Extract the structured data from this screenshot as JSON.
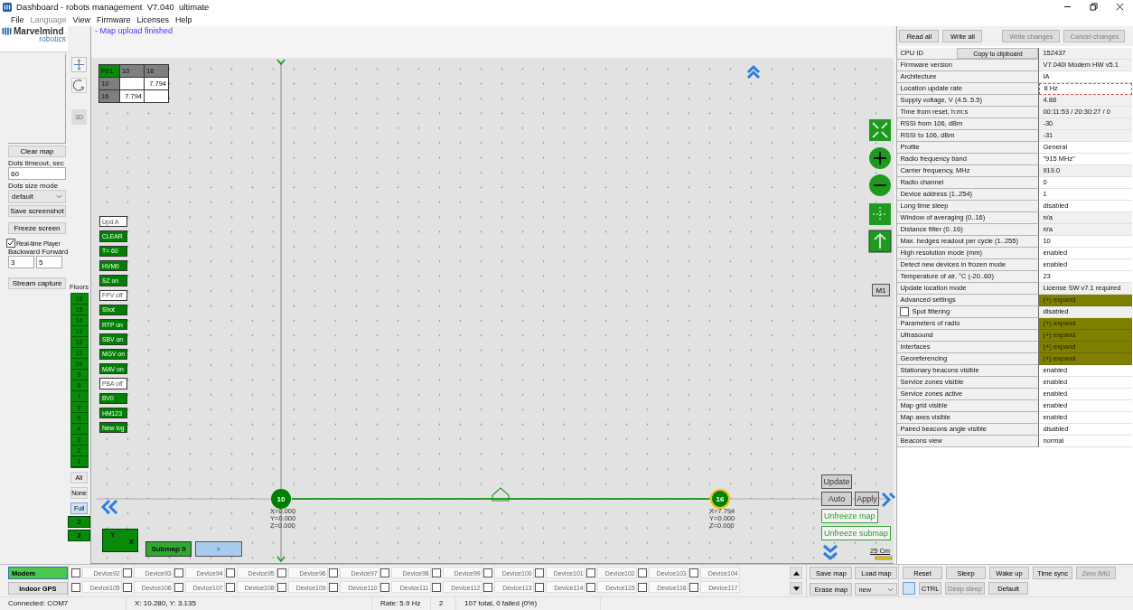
{
  "window": {
    "title": "Dashboard - robots management  V7.040  ultimate"
  },
  "menu": [
    {
      "label": "File",
      "disabled": false
    },
    {
      "label": "Language",
      "disabled": true
    },
    {
      "label": "View",
      "disabled": false
    },
    {
      "label": "Firmware",
      "disabled": false
    },
    {
      "label": "Licenses",
      "disabled": false
    },
    {
      "label": "Help",
      "disabled": false
    }
  ],
  "left_panel": {
    "logo": "Marvelmind",
    "logo_sub": "robotics",
    "clear_button": "Clear map",
    "dots_timeout": {
      "label": "Dots timeout, sec",
      "value": "60"
    },
    "dots_size": {
      "label": "Dots size mode",
      "value": "default"
    },
    "save_button": "Save screenshot",
    "freeze_button": "Freeze screen",
    "player": {
      "label": "Real-time Player",
      "checked": true
    },
    "backward": {
      "label": "Backward",
      "value": "3"
    },
    "forward": {
      "label": "Forward",
      "value": "5"
    },
    "stream_button": "Stream capture"
  },
  "tools": {
    "button_3d": {
      "label": "3D",
      "disabled": true
    },
    "floors_label": "Floors",
    "floors": [
      "16",
      "15",
      "14",
      "13",
      "12",
      "11",
      "10",
      "9",
      "8",
      "7",
      "6",
      "5",
      "4",
      "3",
      "2",
      "1"
    ],
    "filters": [
      {
        "label": "All",
        "selected": false
      },
      {
        "label": "None",
        "selected": false
      },
      {
        "label": "Full",
        "selected": true
      }
    ],
    "levels": [
      "2",
      "2"
    ]
  },
  "map": {
    "message": "- Map upload finished",
    "distance_table": {
      "header": [
        "P01",
        "10",
        "16"
      ],
      "rows": [
        [
          "10",
          null,
          "7.794"
        ],
        [
          "16",
          "7.794",
          null
        ]
      ]
    },
    "toggles": [
      {
        "label": "Upd A",
        "on": false
      },
      {
        "label": "CLEAR",
        "on": true
      },
      {
        "label": "T= 60",
        "on": true
      },
      {
        "label": "HVM0",
        "on": true
      },
      {
        "label": "SZ on",
        "on": true
      },
      {
        "label": "FPV off",
        "on": false
      },
      {
        "label": "Shot",
        "on": true
      },
      {
        "label": "RTP on",
        "on": true
      },
      {
        "label": "SBV on",
        "on": true
      },
      {
        "label": "MGV on",
        "on": true
      },
      {
        "label": "MAV on",
        "on": true
      },
      {
        "label": "PBA off",
        "on": false
      },
      {
        "label": "BV0",
        "on": true
      },
      {
        "label": "HM123",
        "on": true
      },
      {
        "label": "New log",
        "on": true
      }
    ],
    "beacons": [
      {
        "label": "10",
        "selected": false,
        "coords": [
          "X=0.000",
          "Y=0.000",
          "Z=0.000"
        ]
      },
      {
        "label": "16",
        "selected": true,
        "coords": [
          "X=7.794",
          "Y=0.000",
          "Z=0.000"
        ]
      }
    ],
    "m1": "M1",
    "update": "Update",
    "auto": "Auto",
    "apply": "Apply",
    "unfreeze_map": "Unfreeze map",
    "unfreeze_submap": "Unfreeze submap",
    "scale": "25 Cm",
    "axis_y": "Y",
    "axis_x": "X",
    "submap": "Submap 0",
    "submap_add": "+"
  },
  "properties": {
    "buttons": [
      {
        "label": "Read all",
        "disabled": false
      },
      {
        "label": "Write all",
        "disabled": false
      },
      {
        "label": "Write changes",
        "disabled": true
      },
      {
        "label": "Cancel changes",
        "disabled": true
      }
    ],
    "copy_button": "Copy to clipboard",
    "rows": [
      {
        "label": "CPU ID",
        "value": "152437",
        "kind": "readonly"
      },
      {
        "label": "Firmware version",
        "value": "V7.040i Modem HW v5.1",
        "kind": "readonly"
      },
      {
        "label": "Architecture",
        "value": "IA",
        "kind": "edit"
      },
      {
        "label": "Location update rate",
        "value": "8 Hz",
        "kind": "changed"
      },
      {
        "label": "Supply voltage, V (4.5..5.5)",
        "value": "4.88",
        "kind": "readonly"
      },
      {
        "label": "Time from reset, h:m:s",
        "value": "00:11:53 / 20:30:27 / 0",
        "kind": "readonly"
      },
      {
        "label": "RSSI from 106, dBm",
        "value": "-30",
        "kind": "readonly"
      },
      {
        "label": "RSSI to 106, dBm",
        "value": "-31",
        "kind": "readonly"
      },
      {
        "label": "Profile",
        "value": "General",
        "kind": "edit"
      },
      {
        "label": "Radio frequency band",
        "value": "\"915 MHz\"",
        "kind": "edit"
      },
      {
        "label": "Carrier frequency, MHz",
        "value": "919.0",
        "kind": "readonly"
      },
      {
        "label": "Radio channel",
        "value": "0",
        "kind": "edit"
      },
      {
        "label": "Device address (1..254)",
        "value": "1",
        "kind": "edit"
      },
      {
        "label": "Long time sleep",
        "value": "disabled",
        "kind": "edit"
      },
      {
        "label": "Window of averaging (0..16)",
        "value": "n/a",
        "kind": "readonly"
      },
      {
        "label": "Distance filter (0..16)",
        "value": "n/a",
        "kind": "readonly"
      },
      {
        "label": "Max. hedges readout per cycle (1..255)",
        "value": "10",
        "kind": "edit"
      },
      {
        "label": "High resolution mode (mm)",
        "value": "enabled",
        "kind": "edit"
      },
      {
        "label": "Detect new devices in frozen mode",
        "value": "enabled",
        "kind": "edit"
      },
      {
        "label": "Temperature of air, °C (-20..60)",
        "value": "23",
        "kind": "edit"
      },
      {
        "label": "Update location mode",
        "value": "License SW v7.1 required",
        "kind": "readonly"
      },
      {
        "label": "Advanced settings",
        "value": "(+) expand",
        "kind": "expand"
      },
      {
        "label": "Spot filtering",
        "value": "disabled",
        "kind": "check",
        "checked": false
      },
      {
        "label": "Parameters of radio",
        "value": "(+) expand",
        "kind": "expand"
      },
      {
        "label": "Ultrasound",
        "value": "(+) expand",
        "kind": "expand"
      },
      {
        "label": "Interfaces",
        "value": "(+) expand",
        "kind": "expand"
      },
      {
        "label": "Georeferencing",
        "value": "(+) expand",
        "kind": "expand"
      },
      {
        "label": "Stationary beacons visible",
        "value": "enabled",
        "kind": "edit"
      },
      {
        "label": "Service zones visible",
        "value": "enabled",
        "kind": "edit"
      },
      {
        "label": "Service zones active",
        "value": "enabled",
        "kind": "edit"
      },
      {
        "label": "Map grid visible",
        "value": "enabled",
        "kind": "edit"
      },
      {
        "label": "Map axes visible",
        "value": "enabled",
        "kind": "edit"
      },
      {
        "label": "Paired beacons angle visible",
        "value": "disabled",
        "kind": "edit"
      },
      {
        "label": "Beacons view",
        "value": "normal",
        "kind": "edit"
      }
    ]
  },
  "devices": {
    "modes": [
      {
        "label": "Modem",
        "selected": true
      },
      {
        "label": "Indoor GPS",
        "selected": false
      }
    ],
    "items": [
      {
        "label": "Device92",
        "checked": false
      },
      {
        "label": "Device93",
        "checked": false
      },
      {
        "label": "Device94",
        "checked": false
      },
      {
        "label": "Device95",
        "checked": false
      },
      {
        "label": "Device96",
        "checked": false
      },
      {
        "label": "Device97",
        "checked": false
      },
      {
        "label": "Device98",
        "checked": false
      },
      {
        "label": "Device99",
        "checked": false
      },
      {
        "label": "Device100",
        "checked": false
      },
      {
        "label": "Device101",
        "checked": false
      },
      {
        "label": "Device102",
        "checked": false
      },
      {
        "label": "Device103",
        "checked": false
      },
      {
        "label": "Device104",
        "checked": false
      },
      {
        "label": "Device105",
        "checked": false
      },
      {
        "label": "Device106",
        "checked": false
      },
      {
        "label": "Device107",
        "checked": false
      },
      {
        "label": "Device108",
        "checked": false
      },
      {
        "label": "Device109",
        "checked": false
      },
      {
        "label": "Device110",
        "checked": false
      },
      {
        "label": "Device111",
        "checked": false
      },
      {
        "label": "Device112",
        "checked": false
      },
      {
        "label": "Device113",
        "checked": false
      },
      {
        "label": "Device114",
        "checked": false
      },
      {
        "label": "Device115",
        "checked": false
      },
      {
        "label": "Device116",
        "checked": false
      },
      {
        "label": "Device117",
        "checked": false
      }
    ]
  },
  "map_buttons": {
    "save": "Save map",
    "load": "Load map",
    "erase": "Erase map",
    "mode": "new"
  },
  "device_buttons": {
    "row1": [
      {
        "label": "Reset",
        "disabled": false
      },
      {
        "label": "Sleep",
        "disabled": false
      },
      {
        "label": "Wake up",
        "disabled": false
      },
      {
        "label": "Time sync",
        "disabled": false
      },
      {
        "label": "Zero IMU",
        "disabled": true
      }
    ],
    "row2": [
      {
        "label": "CTRL",
        "disabled": false
      },
      {
        "label": "Deep sleep",
        "disabled": true
      },
      {
        "label": "Default",
        "disabled": false
      }
    ]
  },
  "status_bar": [
    "Connected: COM7",
    "X: 10.280, Y: 3.135",
    "Rate: 5.9 Hz",
    "2",
    "107 total, 0 failed (0%)"
  ]
}
